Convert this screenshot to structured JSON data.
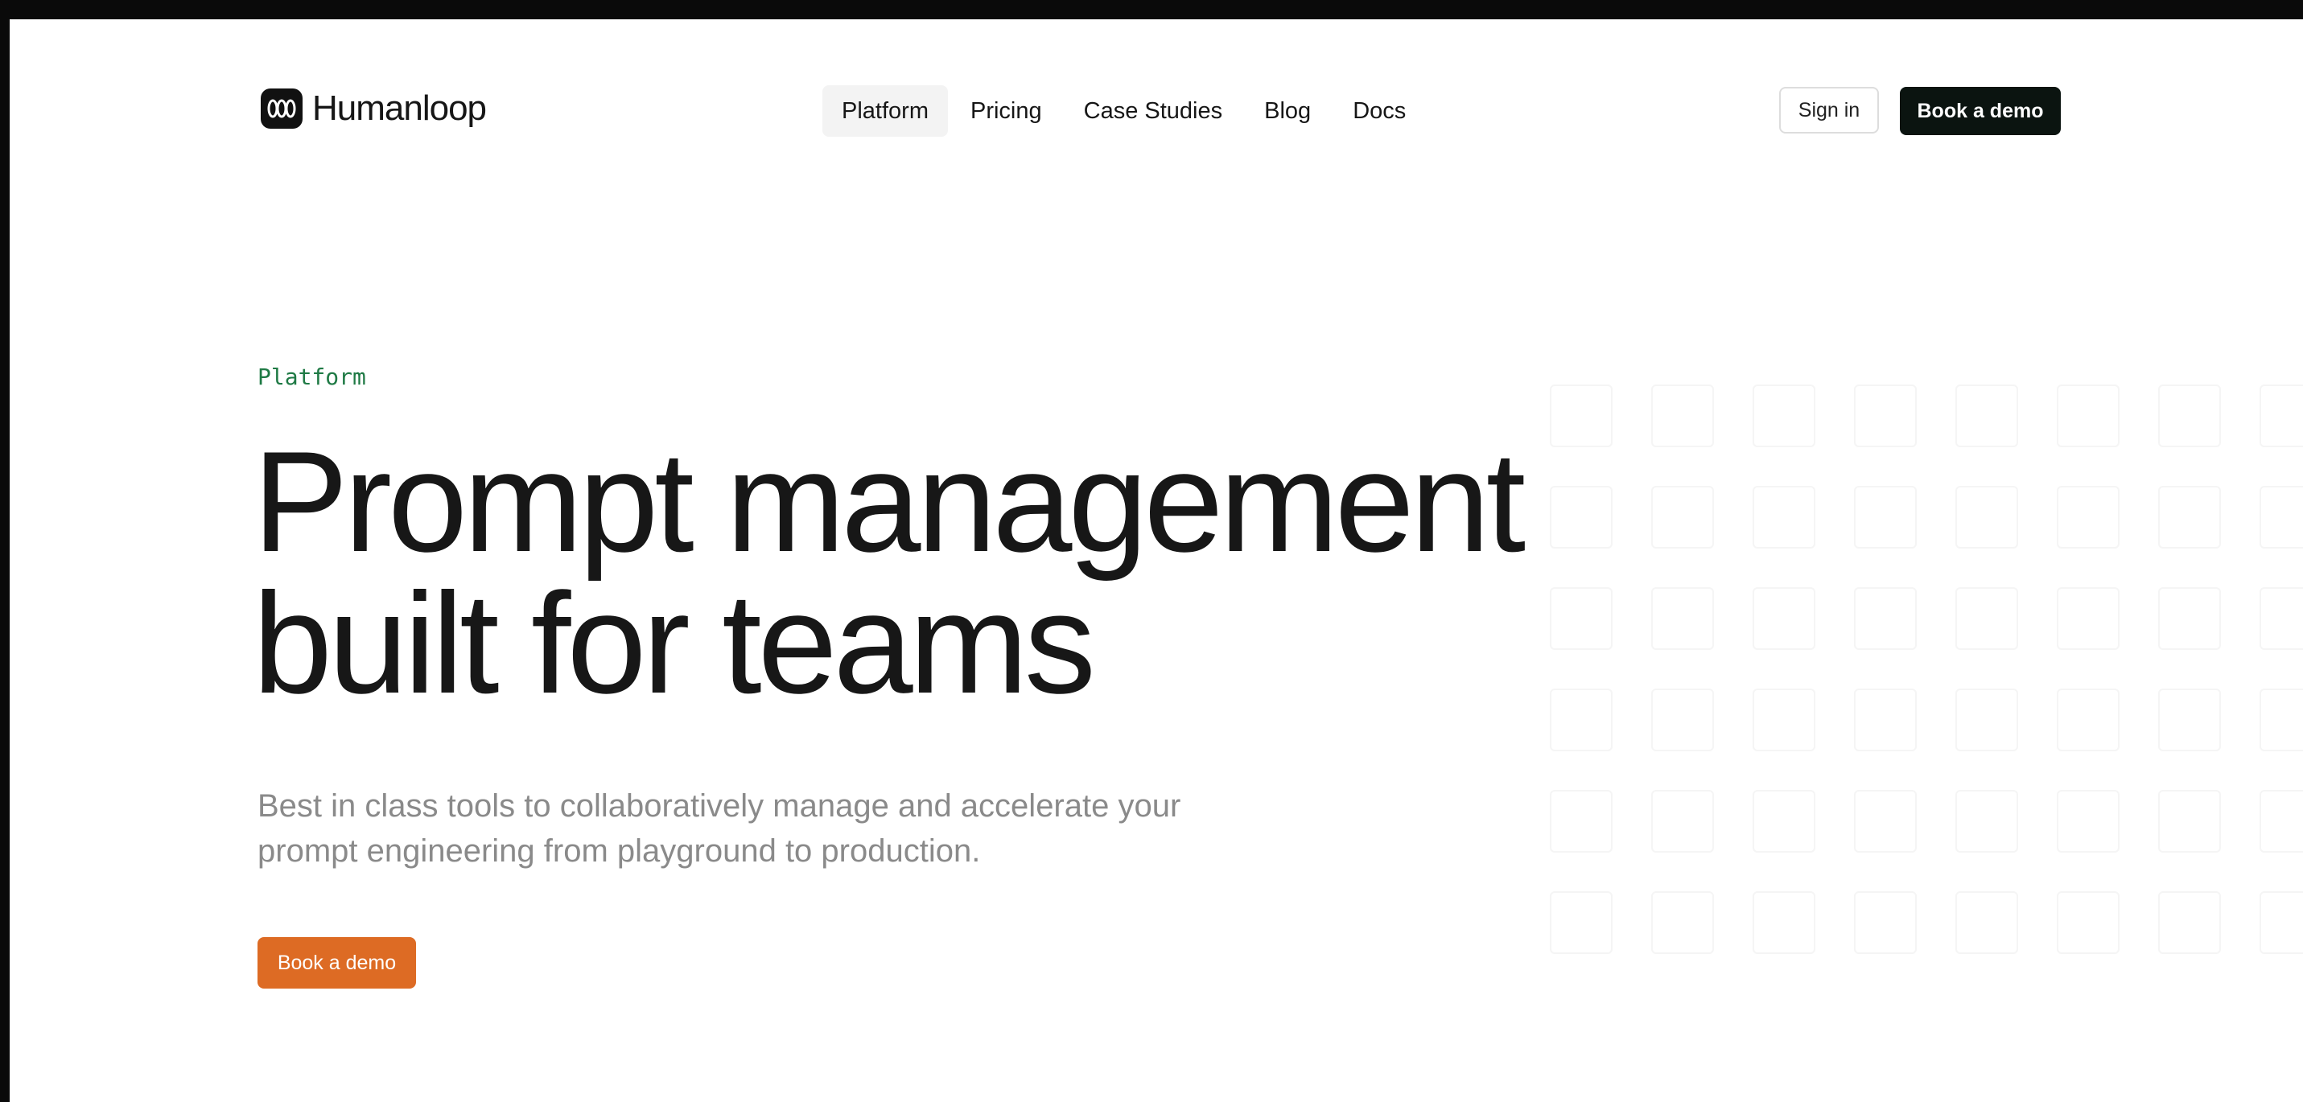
{
  "brand": {
    "name": "Humanloop",
    "logo_icon": "humanloop-logo-icon"
  },
  "nav": {
    "items": [
      {
        "label": "Platform",
        "active": true
      },
      {
        "label": "Pricing",
        "active": false
      },
      {
        "label": "Case Studies",
        "active": false
      },
      {
        "label": "Blog",
        "active": false
      },
      {
        "label": "Docs",
        "active": false
      }
    ]
  },
  "header": {
    "signin_label": "Sign in",
    "demo_label": "Book a demo"
  },
  "hero": {
    "eyebrow": "Platform",
    "headline_line1": "Prompt management",
    "headline_line2": "built for teams",
    "subtitle_line1": "Best in class tools to collaboratively manage and accelerate your",
    "subtitle_line2": "prompt engineering from playground to production.",
    "cta_label": "Book a demo"
  },
  "colors": {
    "accent": "#dd6b24",
    "dark_button": "#0b1410",
    "eyebrow": "#1f7a45",
    "nav_active_bg": "#f3f3f3"
  }
}
